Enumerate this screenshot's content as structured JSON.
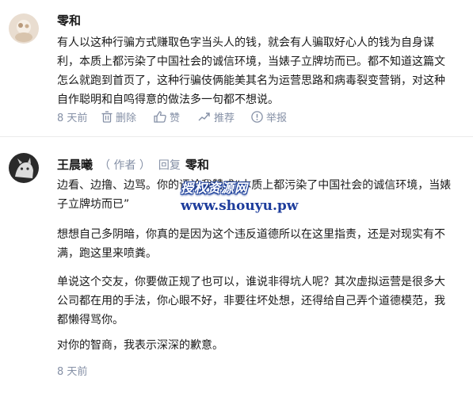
{
  "comments": [
    {
      "username": "零和",
      "text": "有人以这种行骗方式赚取色字当头人的钱，就会有人骗取好心人的钱为自身谋利，本质上都污染了中国社会的诚信环境，当婊子立牌坊而已。都不知道这篇文怎么就跑到首页了，这种行骗伎俩能美其名为运营思路和病毒裂变营销，对这种自作聪明和自鸣得意的做法多一句都不想说。",
      "time": "8 天前",
      "actions": {
        "delete": "删除",
        "like": "赞",
        "recommend": "推荐",
        "report": "举报"
      }
    },
    {
      "username": "王晨曦",
      "author_tag": "（ 作者 ）",
      "reply_verb": "回复",
      "reply_target": "零和",
      "paragraphs": [
        "边看、边撸、边骂。你的评论我赞成“本质上都污染了中国社会的诚信环境，当婊子立牌坊而已”",
        "想想自己多阴暗，你真的是因为这个违反道德所以在这里指责，还是对现实有不满，跑这里来喷粪。",
        "单说这个交友，你要做正规了也可以，谁说非得坑人呢？其次虚拟运营是很多大公司都在用的手法，你心眼不好，非要往坏处想，还得给自己弄个道德模范，我都懒得骂你。",
        "对你的智商，我表示深深的歉意。"
      ],
      "time": "8 天前"
    }
  ],
  "watermark": {
    "text_cn": "授权资源网",
    "url": "www.shouyu.pw",
    "color": "#1e3d9c"
  },
  "colors": {
    "meta": "#8590a6",
    "text": "#1a1a1a",
    "divider": "#ebebeb"
  },
  "icons": [
    "trash-icon",
    "thumbs-up-icon",
    "recommend-icon",
    "report-icon"
  ]
}
